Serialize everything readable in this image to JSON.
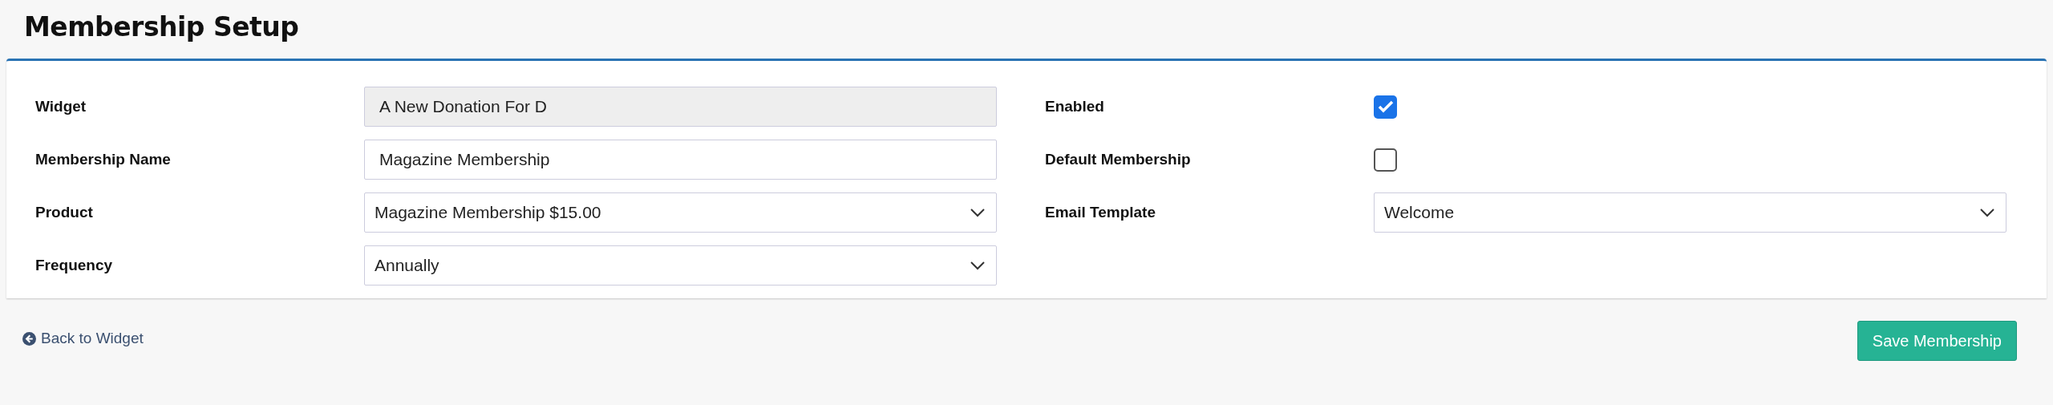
{
  "title": "Membership Setup",
  "left_fields": [
    {
      "label": "Widget",
      "kind": "text",
      "value": "A New Donation For D",
      "disabled": true
    },
    {
      "label": "Membership Name",
      "kind": "text",
      "value": "Magazine Membership",
      "disabled": false
    },
    {
      "label": "Product",
      "kind": "select",
      "value": "Magazine Membership $15.00",
      "disabled": false
    },
    {
      "label": "Frequency",
      "kind": "select",
      "value": "Annually",
      "disabled": false
    }
  ],
  "right_fields": [
    {
      "label": "Enabled",
      "kind": "checkbox",
      "checked": true,
      "disabled": false
    },
    {
      "label": "Default Membership",
      "kind": "checkbox",
      "checked": false,
      "disabled": false
    },
    {
      "label": "Email Template",
      "kind": "select",
      "value": "Welcome",
      "disabled": false
    }
  ],
  "back_link": "Back to Widget",
  "save_button": "Save Membership"
}
